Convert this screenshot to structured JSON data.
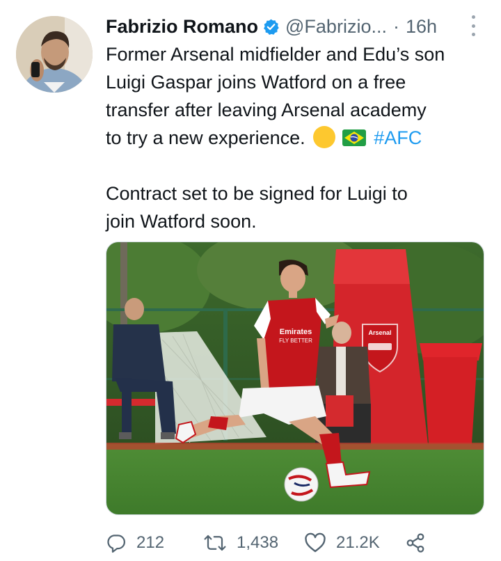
{
  "tweet": {
    "author": {
      "display_name": "Fabrizio Romano",
      "handle": "@Fabrizio...",
      "verified": true
    },
    "separator": "·",
    "timestamp": "16h",
    "text": {
      "line1": "Former Arsenal midfielder and Edu’s son",
      "line2": "Luigi Gaspar joins Watford on a free",
      "line3": "transfer after leaving Arsenal academy",
      "line4_prefix": "to try a new experience.",
      "hashtag": "#AFC",
      "para2_line1": "Contract set to be signed for Luigi to",
      "para2_line2": "join Watford soon."
    },
    "emojis": [
      "yellow-circle",
      "brazil-flag"
    ],
    "media": {
      "jersey_sponsor_line1": "Emirates",
      "jersey_sponsor_line2": "FLY BETTER",
      "stand_text": "Arsenal"
    },
    "actions": {
      "replies": "212",
      "retweets": "1,438",
      "likes": "21.2K"
    }
  },
  "colors": {
    "link": "#1d9bf0",
    "secondary": "#536471",
    "verified": "#1d9bf0",
    "arsenal_red": "#db0007"
  }
}
